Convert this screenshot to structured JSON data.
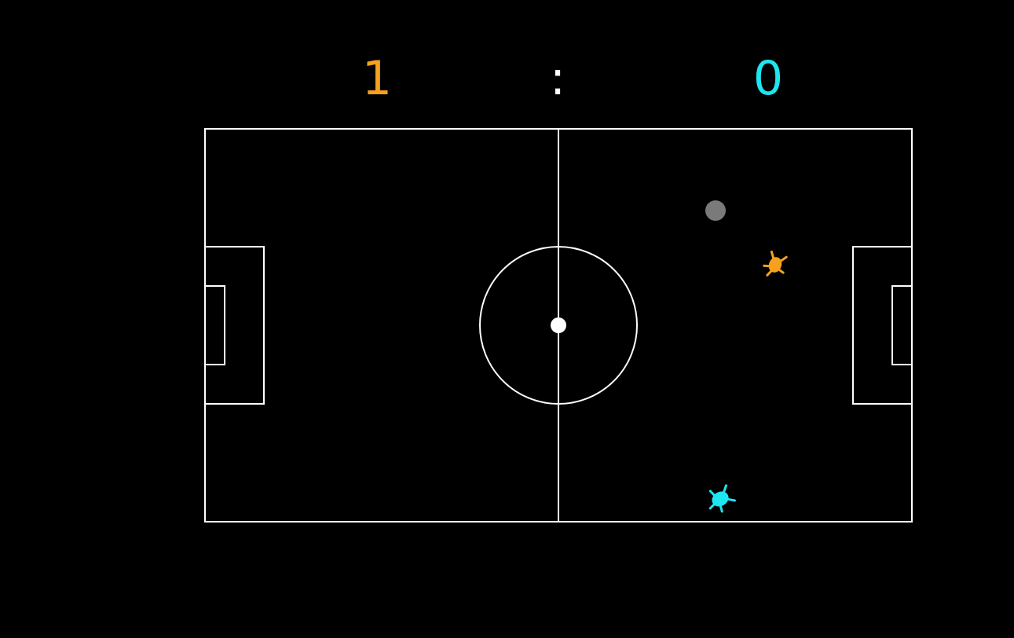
{
  "scoreboard": {
    "left_score": "1",
    "separator": ":",
    "right_score": "0",
    "left_color": "#f5a11e",
    "right_color": "#1ee6f0"
  },
  "field": {
    "line_color": "#ffffff",
    "background_color": "#000000"
  },
  "entities": {
    "ball_color": "#7a7a7a",
    "orange_player_color": "#f5a11e",
    "cyan_player_color": "#1ee6f0"
  }
}
